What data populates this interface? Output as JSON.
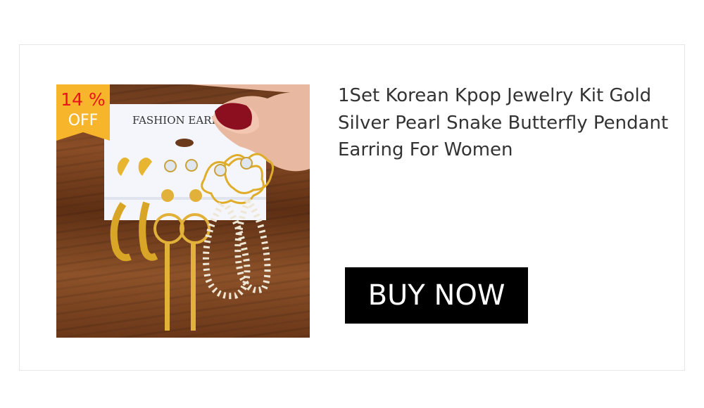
{
  "product": {
    "title": "1Set Korean Kpop Jewelry Kit Gold Silver Pearl Snake Butterfly Pendant Earring For Women",
    "card_text": "FASHION EARRI",
    "discount": {
      "percent": "14 %",
      "label": "OFF"
    },
    "buy_label": "BUY NOW"
  },
  "colors": {
    "badge_background": "#f7b52c",
    "badge_percent": "#e8141b",
    "button_background": "#000000",
    "button_text": "#ffffff",
    "title_text": "#333333"
  }
}
